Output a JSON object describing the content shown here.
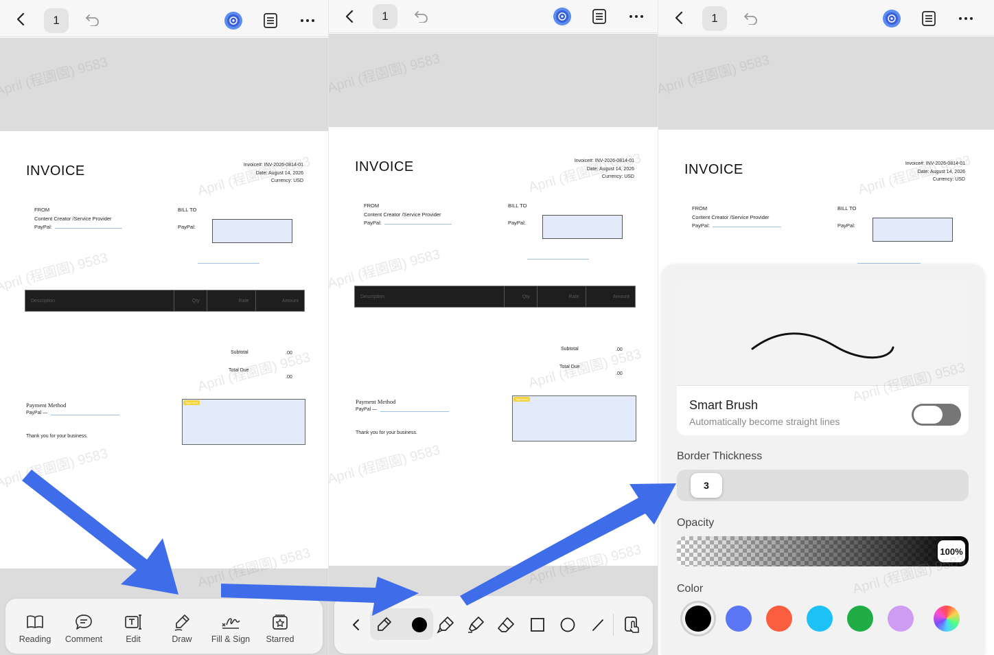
{
  "topbar": {
    "page_number": "1"
  },
  "invoice": {
    "title": "INVOICE",
    "number_line": "Invoice#: INV-2026-0814-01",
    "date_line": "Date: August 14, 2026",
    "currency_line": "Currency: USD",
    "from_label": "FROM",
    "from_name": "Content Creator /Service Provider",
    "from_paypal": "PayPal:",
    "billto_label": "BILL TO",
    "billto_paypal": "PayPal:",
    "columns": [
      "Description",
      "Qty",
      "Rate",
      "Amount"
    ],
    "subtotal_label": "Subtotal",
    "subtotal_value": ".00",
    "total_label": "Total Due",
    "total_value": ".00",
    "payment_method": "Payment Method",
    "payment_paypal": "PayPal —",
    "thanks": "Thank you for your business.",
    "sign_tag": "Sign Here"
  },
  "watermark": {
    "text": "April (程園園) 9583"
  },
  "toolbar_main": {
    "items": [
      {
        "label": "Reading",
        "icon": "book-icon"
      },
      {
        "label": "Comment",
        "icon": "comment-icon"
      },
      {
        "label": "Edit",
        "icon": "text-edit-icon"
      },
      {
        "label": "Draw",
        "icon": "pen-icon"
      },
      {
        "label": "Fill & Sign",
        "icon": "signature-icon"
      },
      {
        "label": "Starred",
        "icon": "star-box-icon"
      }
    ]
  },
  "draw_toolbar": {
    "selected_tool": "pen-icon",
    "selected_color": "#000000",
    "tools": [
      "chevron-left-icon",
      "pen-icon",
      "color-dot",
      "marker-icon",
      "highlighter-icon",
      "eraser-icon",
      "rectangle-icon",
      "circle-icon",
      "line-icon",
      "touch-pen-icon"
    ]
  },
  "brush_settings": {
    "smart_brush_title": "Smart Brush",
    "smart_brush_desc": "Automatically become straight lines",
    "smart_brush_on": false,
    "thickness_label": "Border Thickness",
    "thickness_value": "3",
    "opacity_label": "Opacity",
    "opacity_value": "100%",
    "color_label": "Color",
    "colors": [
      "#000000",
      "#5b76f5",
      "#fb5d3f",
      "#1ec1f5",
      "#21ad45",
      "#cf9cf4",
      "rainbow"
    ],
    "selected_color": "#000000"
  },
  "colors": {
    "arrow": "#3f6ce8",
    "accent": "#3f6ce8"
  }
}
